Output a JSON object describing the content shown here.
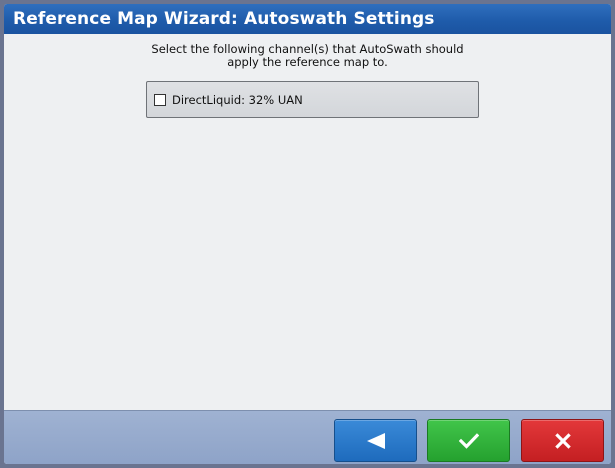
{
  "window": {
    "title": "Reference Map Wizard: Autoswath Settings"
  },
  "instruction": {
    "line1": "Select the following channel(s) that AutoSwath should",
    "line2": "apply the reference map to."
  },
  "channels": [
    {
      "label": "DirectLiquid: 32% UAN",
      "checked": false
    }
  ],
  "footer": {
    "back_icon": "left-triangle-icon",
    "ok_icon": "checkmark-icon",
    "cancel_icon": "close-x-icon"
  },
  "colors": {
    "title_bar": "#1f5cab",
    "back_button": "#2a7ccc",
    "ok_button": "#31b23b",
    "cancel_button": "#d62a2c"
  }
}
